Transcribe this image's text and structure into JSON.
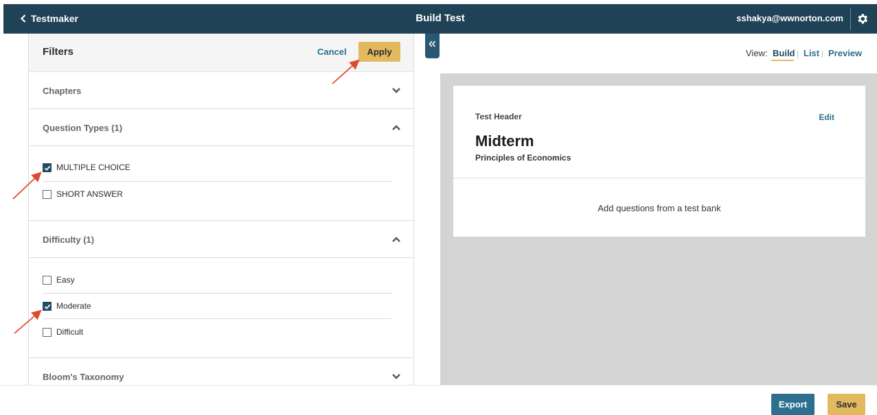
{
  "topbar": {
    "back_label": "Testmaker",
    "title": "Build Test",
    "user_email": "sshakya@wwnorton.com"
  },
  "filters": {
    "title": "Filters",
    "cancel_label": "Cancel",
    "apply_label": "Apply",
    "sections": [
      {
        "title": "Chapters",
        "expanded": false,
        "options": []
      },
      {
        "title": "Question Types (1)",
        "expanded": true,
        "options": [
          {
            "label": "MULTIPLE CHOICE",
            "checked": true
          },
          {
            "label": "SHORT ANSWER",
            "checked": false
          }
        ]
      },
      {
        "title": "Difficulty (1)",
        "expanded": true,
        "options": [
          {
            "label": "Easy",
            "checked": false
          },
          {
            "label": "Moderate",
            "checked": true
          },
          {
            "label": "Difficult",
            "checked": false
          }
        ]
      },
      {
        "title": "Bloom's Taxonomy",
        "expanded": false,
        "options": []
      }
    ]
  },
  "view": {
    "label": "View:",
    "options": [
      "Build",
      "List",
      "Preview"
    ],
    "active": "Build"
  },
  "test_card": {
    "header_label": "Test Header",
    "edit_label": "Edit",
    "title": "Midterm",
    "subtitle": "Principles of Economics",
    "empty_message": "Add questions from a test bank"
  },
  "footer": {
    "export_label": "Export",
    "save_label": "Save"
  },
  "colors": {
    "topbar": "#1f4256",
    "accent_gold": "#e3b95f",
    "link_blue": "#2c6f8e",
    "checkbox_checked": "#234a63",
    "annotation_arrow": "#e0492d"
  },
  "icons": {
    "back": "chevron-left-icon",
    "settings": "gear-icon",
    "collapse": "double-chevron-left-icon",
    "expand": "chevron-down-icon",
    "collapse_section": "chevron-up-icon"
  }
}
